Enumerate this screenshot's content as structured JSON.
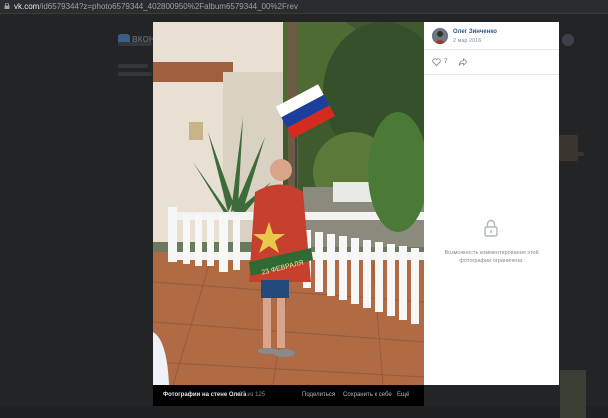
{
  "browser": {
    "url_host": "vk.com",
    "url_path": "/id6579344?z=photo6579344_402800950%2Falbum6579344_00%2Frev"
  },
  "background_page": {
    "logo_text": "ВКОН"
  },
  "photo_viewer": {
    "flag_colors": [
      "#ffffff",
      "#1c3f9e",
      "#d52b1e"
    ],
    "towel_text": "23 ФЕВРАЛЯ",
    "footer": {
      "album_title": "Фотографии на стене Олега",
      "counter": "27 из 125",
      "share_label": "Поделиться",
      "save_label": "Сохранить к себе",
      "more_label": "Ещё"
    }
  },
  "side_panel": {
    "author_name": "Олег Зинченко",
    "date": "2 мар 2016",
    "likes_count": "7",
    "comments_disabled_text": "Возможность комментирования этой фотографии ограничена.",
    "icons": [
      "heart-icon",
      "share-icon",
      "lock-icon"
    ]
  }
}
